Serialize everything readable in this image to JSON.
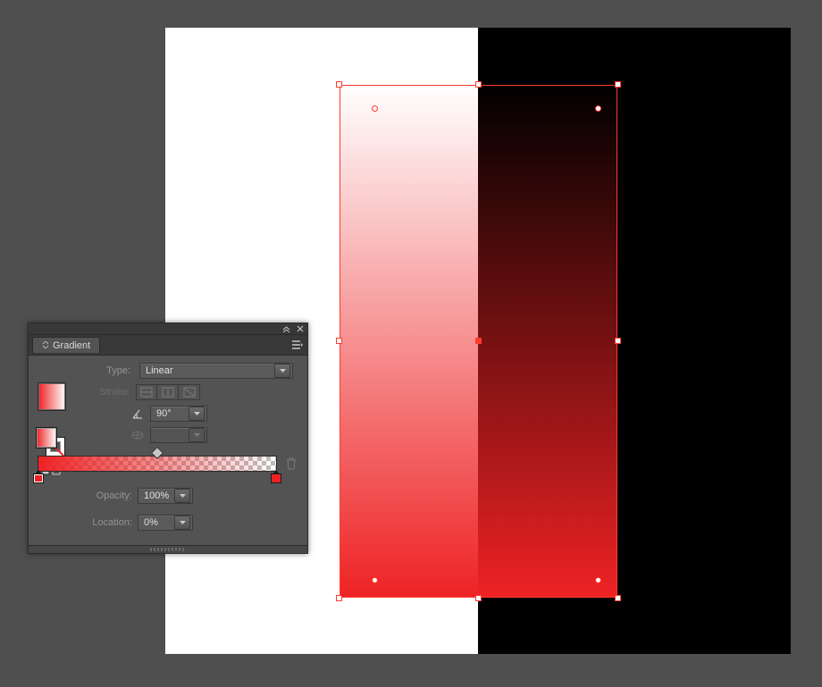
{
  "panel": {
    "title": "Gradient",
    "type_label": "Type:",
    "type_value": "Linear",
    "stroke_label": "Stroke:",
    "angle_value": "90°",
    "aspect_value": "",
    "opacity_label": "Opacity:",
    "opacity_value": "100%",
    "location_label": "Location:",
    "location_value": "0%"
  },
  "gradient": {
    "stops": [
      {
        "color": "#ee2224",
        "opacity": 100,
        "location": 0
      },
      {
        "color": "#ee2224",
        "opacity": 0,
        "location": 100
      }
    ],
    "angle": 90,
    "type": "Linear"
  }
}
